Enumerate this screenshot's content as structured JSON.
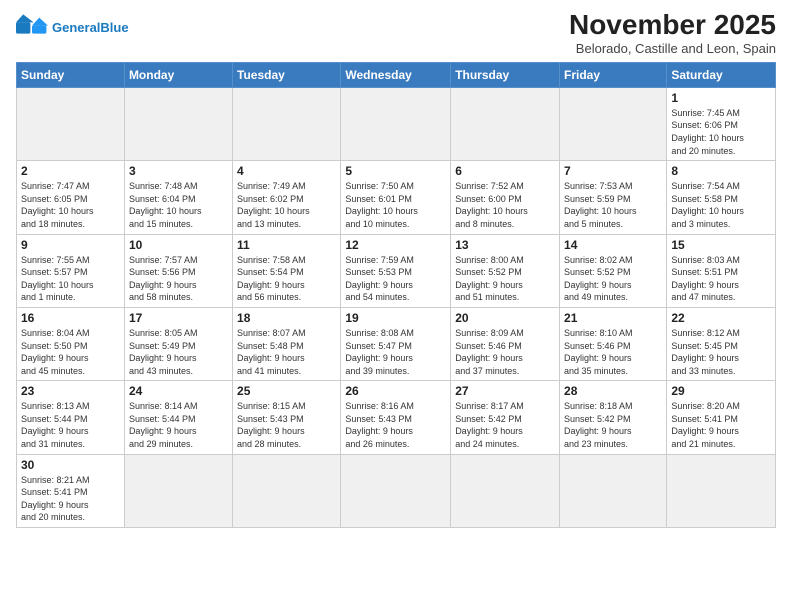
{
  "logo": {
    "text_general": "General",
    "text_blue": "Blue"
  },
  "header": {
    "month": "November 2025",
    "location": "Belorado, Castille and Leon, Spain"
  },
  "weekdays": [
    "Sunday",
    "Monday",
    "Tuesday",
    "Wednesday",
    "Thursday",
    "Friday",
    "Saturday"
  ],
  "weeks": [
    [
      {
        "day": null,
        "info": null
      },
      {
        "day": null,
        "info": null
      },
      {
        "day": null,
        "info": null
      },
      {
        "day": null,
        "info": null
      },
      {
        "day": null,
        "info": null
      },
      {
        "day": null,
        "info": null
      },
      {
        "day": "1",
        "info": "Sunrise: 7:45 AM\nSunset: 6:06 PM\nDaylight: 10 hours\nand 20 minutes."
      }
    ],
    [
      {
        "day": "2",
        "info": "Sunrise: 7:47 AM\nSunset: 6:05 PM\nDaylight: 10 hours\nand 18 minutes."
      },
      {
        "day": "3",
        "info": "Sunrise: 7:48 AM\nSunset: 6:04 PM\nDaylight: 10 hours\nand 15 minutes."
      },
      {
        "day": "4",
        "info": "Sunrise: 7:49 AM\nSunset: 6:02 PM\nDaylight: 10 hours\nand 13 minutes."
      },
      {
        "day": "5",
        "info": "Sunrise: 7:50 AM\nSunset: 6:01 PM\nDaylight: 10 hours\nand 10 minutes."
      },
      {
        "day": "6",
        "info": "Sunrise: 7:52 AM\nSunset: 6:00 PM\nDaylight: 10 hours\nand 8 minutes."
      },
      {
        "day": "7",
        "info": "Sunrise: 7:53 AM\nSunset: 5:59 PM\nDaylight: 10 hours\nand 5 minutes."
      },
      {
        "day": "8",
        "info": "Sunrise: 7:54 AM\nSunset: 5:58 PM\nDaylight: 10 hours\nand 3 minutes."
      }
    ],
    [
      {
        "day": "9",
        "info": "Sunrise: 7:55 AM\nSunset: 5:57 PM\nDaylight: 10 hours\nand 1 minute."
      },
      {
        "day": "10",
        "info": "Sunrise: 7:57 AM\nSunset: 5:56 PM\nDaylight: 9 hours\nand 58 minutes."
      },
      {
        "day": "11",
        "info": "Sunrise: 7:58 AM\nSunset: 5:54 PM\nDaylight: 9 hours\nand 56 minutes."
      },
      {
        "day": "12",
        "info": "Sunrise: 7:59 AM\nSunset: 5:53 PM\nDaylight: 9 hours\nand 54 minutes."
      },
      {
        "day": "13",
        "info": "Sunrise: 8:00 AM\nSunset: 5:52 PM\nDaylight: 9 hours\nand 51 minutes."
      },
      {
        "day": "14",
        "info": "Sunrise: 8:02 AM\nSunset: 5:52 PM\nDaylight: 9 hours\nand 49 minutes."
      },
      {
        "day": "15",
        "info": "Sunrise: 8:03 AM\nSunset: 5:51 PM\nDaylight: 9 hours\nand 47 minutes."
      }
    ],
    [
      {
        "day": "16",
        "info": "Sunrise: 8:04 AM\nSunset: 5:50 PM\nDaylight: 9 hours\nand 45 minutes."
      },
      {
        "day": "17",
        "info": "Sunrise: 8:05 AM\nSunset: 5:49 PM\nDaylight: 9 hours\nand 43 minutes."
      },
      {
        "day": "18",
        "info": "Sunrise: 8:07 AM\nSunset: 5:48 PM\nDaylight: 9 hours\nand 41 minutes."
      },
      {
        "day": "19",
        "info": "Sunrise: 8:08 AM\nSunset: 5:47 PM\nDaylight: 9 hours\nand 39 minutes."
      },
      {
        "day": "20",
        "info": "Sunrise: 8:09 AM\nSunset: 5:46 PM\nDaylight: 9 hours\nand 37 minutes."
      },
      {
        "day": "21",
        "info": "Sunrise: 8:10 AM\nSunset: 5:46 PM\nDaylight: 9 hours\nand 35 minutes."
      },
      {
        "day": "22",
        "info": "Sunrise: 8:12 AM\nSunset: 5:45 PM\nDaylight: 9 hours\nand 33 minutes."
      }
    ],
    [
      {
        "day": "23",
        "info": "Sunrise: 8:13 AM\nSunset: 5:44 PM\nDaylight: 9 hours\nand 31 minutes."
      },
      {
        "day": "24",
        "info": "Sunrise: 8:14 AM\nSunset: 5:44 PM\nDaylight: 9 hours\nand 29 minutes."
      },
      {
        "day": "25",
        "info": "Sunrise: 8:15 AM\nSunset: 5:43 PM\nDaylight: 9 hours\nand 28 minutes."
      },
      {
        "day": "26",
        "info": "Sunrise: 8:16 AM\nSunset: 5:43 PM\nDaylight: 9 hours\nand 26 minutes."
      },
      {
        "day": "27",
        "info": "Sunrise: 8:17 AM\nSunset: 5:42 PM\nDaylight: 9 hours\nand 24 minutes."
      },
      {
        "day": "28",
        "info": "Sunrise: 8:18 AM\nSunset: 5:42 PM\nDaylight: 9 hours\nand 23 minutes."
      },
      {
        "day": "29",
        "info": "Sunrise: 8:20 AM\nSunset: 5:41 PM\nDaylight: 9 hours\nand 21 minutes."
      }
    ],
    [
      {
        "day": "30",
        "info": "Sunrise: 8:21 AM\nSunset: 5:41 PM\nDaylight: 9 hours\nand 20 minutes."
      },
      {
        "day": null,
        "info": null
      },
      {
        "day": null,
        "info": null
      },
      {
        "day": null,
        "info": null
      },
      {
        "day": null,
        "info": null
      },
      {
        "day": null,
        "info": null
      },
      {
        "day": null,
        "info": null
      }
    ]
  ]
}
